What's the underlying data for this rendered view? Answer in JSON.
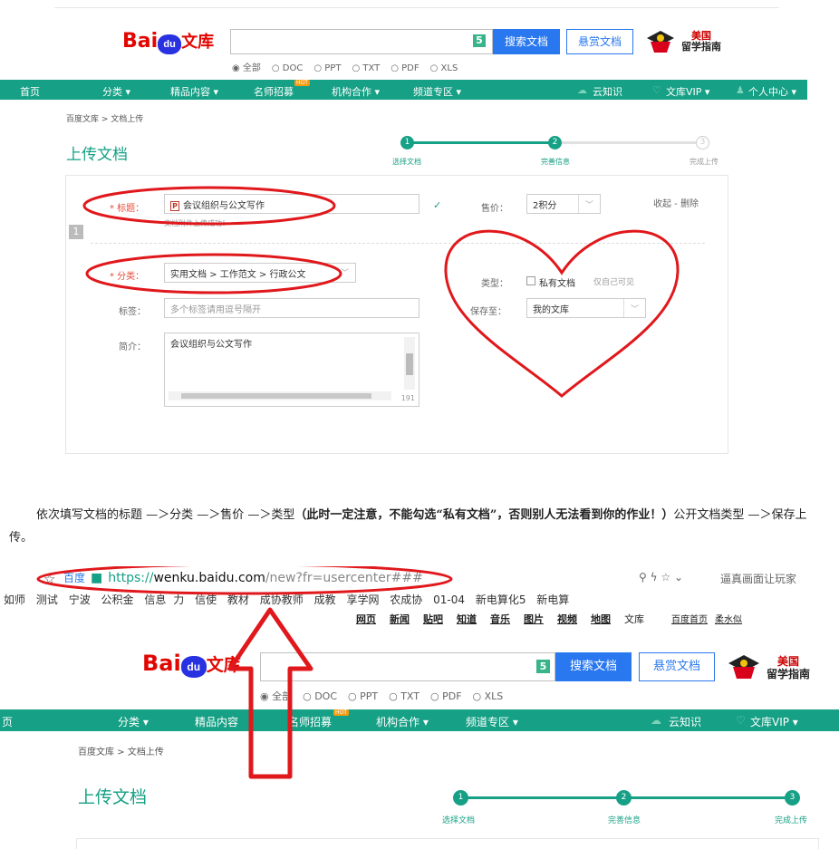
{
  "top": {
    "logo": {
      "bai": "Bai",
      "du": "du",
      "wenku": "文库"
    },
    "search_badge": "5",
    "search_button": "搜索文档",
    "reward_button": "悬赏文档",
    "radio_options": [
      "◉ 全部",
      "○ DOC",
      "○ PPT",
      "○ TXT",
      "○ PDF",
      "○ XLS"
    ],
    "promo_line1": "美国",
    "promo_line2": "留学指南"
  },
  "nav": {
    "home": "首页",
    "category": "分类 ▾",
    "featured": "精品内容 ▾",
    "teacher": "名师招募",
    "hot": "HOT",
    "org": "机构合作 ▾",
    "channel": "频道专区 ▾",
    "cloud": "云知识",
    "vip": "文库VIP ▾",
    "user": "个人中心 ▾"
  },
  "breadcrumb": "百度文库 > 文档上传",
  "page_title": "上传文档",
  "steps": [
    {
      "num": "1",
      "label": "选择文档"
    },
    {
      "num": "2",
      "label": "完善信息"
    },
    {
      "num": "3",
      "label": "完成上传"
    }
  ],
  "form": {
    "index": "1",
    "title_label": "* 标题：",
    "title_icon": "P",
    "title_value": "会议组织与公文写作",
    "title_hint": "文档附件上传成功！",
    "price_label": "售价：",
    "price_value": "2积分",
    "actions": "收起 - 删除",
    "category_label": "* 分类：",
    "category_value": "实用文档 > 工作范文 > 行政公文",
    "tags_label": "标签：",
    "tags_placeholder": "多个标签请用逗号隔开",
    "intro_label": "简介：",
    "intro_value": "会议组织与公文写作",
    "intro_count": "191",
    "type_label": "类型：",
    "type_private": "私有文档",
    "type_hint": "仅自己可见",
    "save_label": "保存至：",
    "save_value": "我的文库"
  },
  "paragraph": {
    "part1": "依次填写文档的标题 —＞分类 —＞售价 —＞类型",
    "part2_bold": "（此时一定注意，不能勾选“私有文档”，否则别人无法看到你的作业！）",
    "part3": "公开文档类型 —＞保存上传。"
  },
  "browser": {
    "url_prefix": "百度",
    "url_https": "https://",
    "url_domain": "wenku.baidu.com",
    "url_rest": "/new?fr=usercenter###",
    "right_text": "逼真画面让玩家",
    "bookmarks": [
      "如师",
      "测试",
      "宁波",
      "公积金",
      "信息",
      "力",
      "信使",
      "教材",
      "成协教师",
      "成教",
      "享学网",
      "农成协",
      "01-04",
      "新电算化5",
      "新电算"
    ],
    "top_links": [
      "网页",
      "新闻",
      "贴吧",
      "知道",
      "音乐",
      "图片",
      "视频",
      "地图",
      "文库",
      "百度首页",
      "柔水似"
    ]
  },
  "annotation_colors": {
    "ellipse": "#e0181c",
    "heart": "#e0181c",
    "arrow": "#e0181c"
  }
}
